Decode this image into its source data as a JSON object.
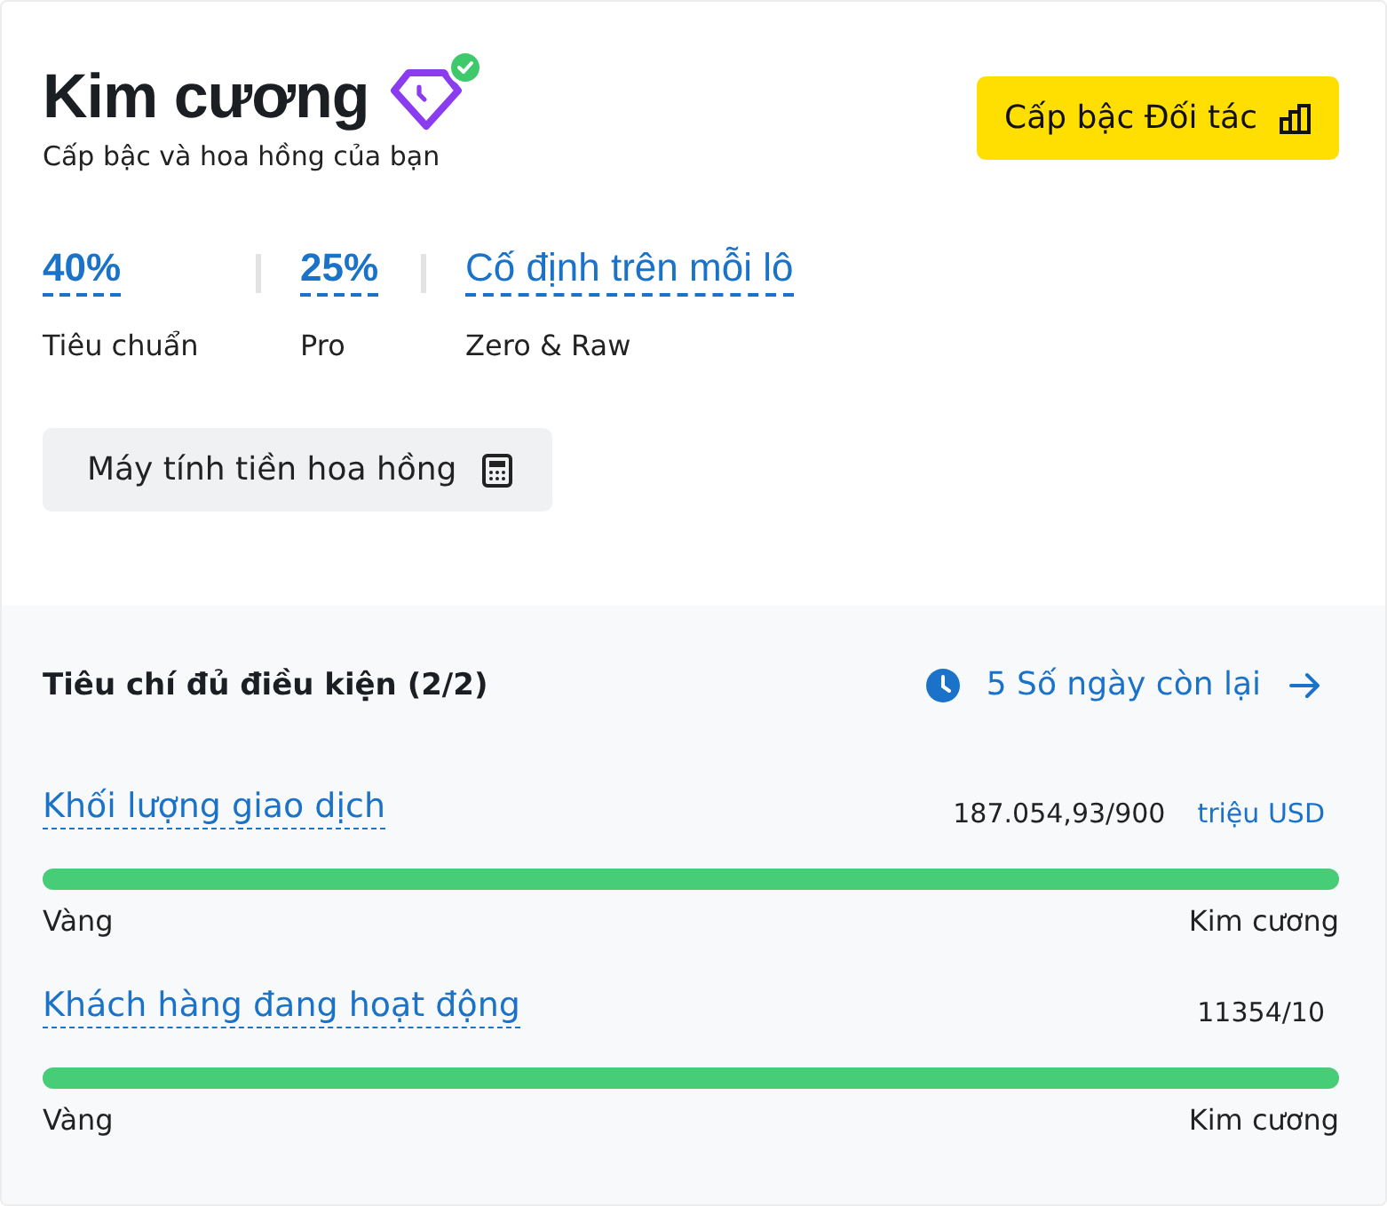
{
  "tier": {
    "name": "Kim cương",
    "verified": true,
    "subtitle": "Cấp bậc và hoa hồng của bạn"
  },
  "partner_button": {
    "label": "Cấp bậc Đối tác"
  },
  "commissions": [
    {
      "value": "40%",
      "label": "Tiêu chuẩn"
    },
    {
      "value": "25%",
      "label": "Pro"
    },
    {
      "value": "Cố định trên mỗi lô",
      "label": "Zero & Raw"
    }
  ],
  "calculator_button": {
    "label": "Máy tính tiền hoa hồng"
  },
  "criteria": {
    "title": "Tiêu chí đủ điều kiện (2/2)",
    "days_link": "5 Số ngày còn lại",
    "items": [
      {
        "name": "Khối lượng giao dịch",
        "reading": "187.054,93/900",
        "unit": "triệu USD",
        "level": 1,
        "from": "Vàng",
        "to": "Kim cương"
      },
      {
        "name": "Khách hàng đang hoạt động",
        "reading": "11354/10",
        "level": 1,
        "from": "Vàng",
        "to": "Kim cương"
      }
    ]
  }
}
